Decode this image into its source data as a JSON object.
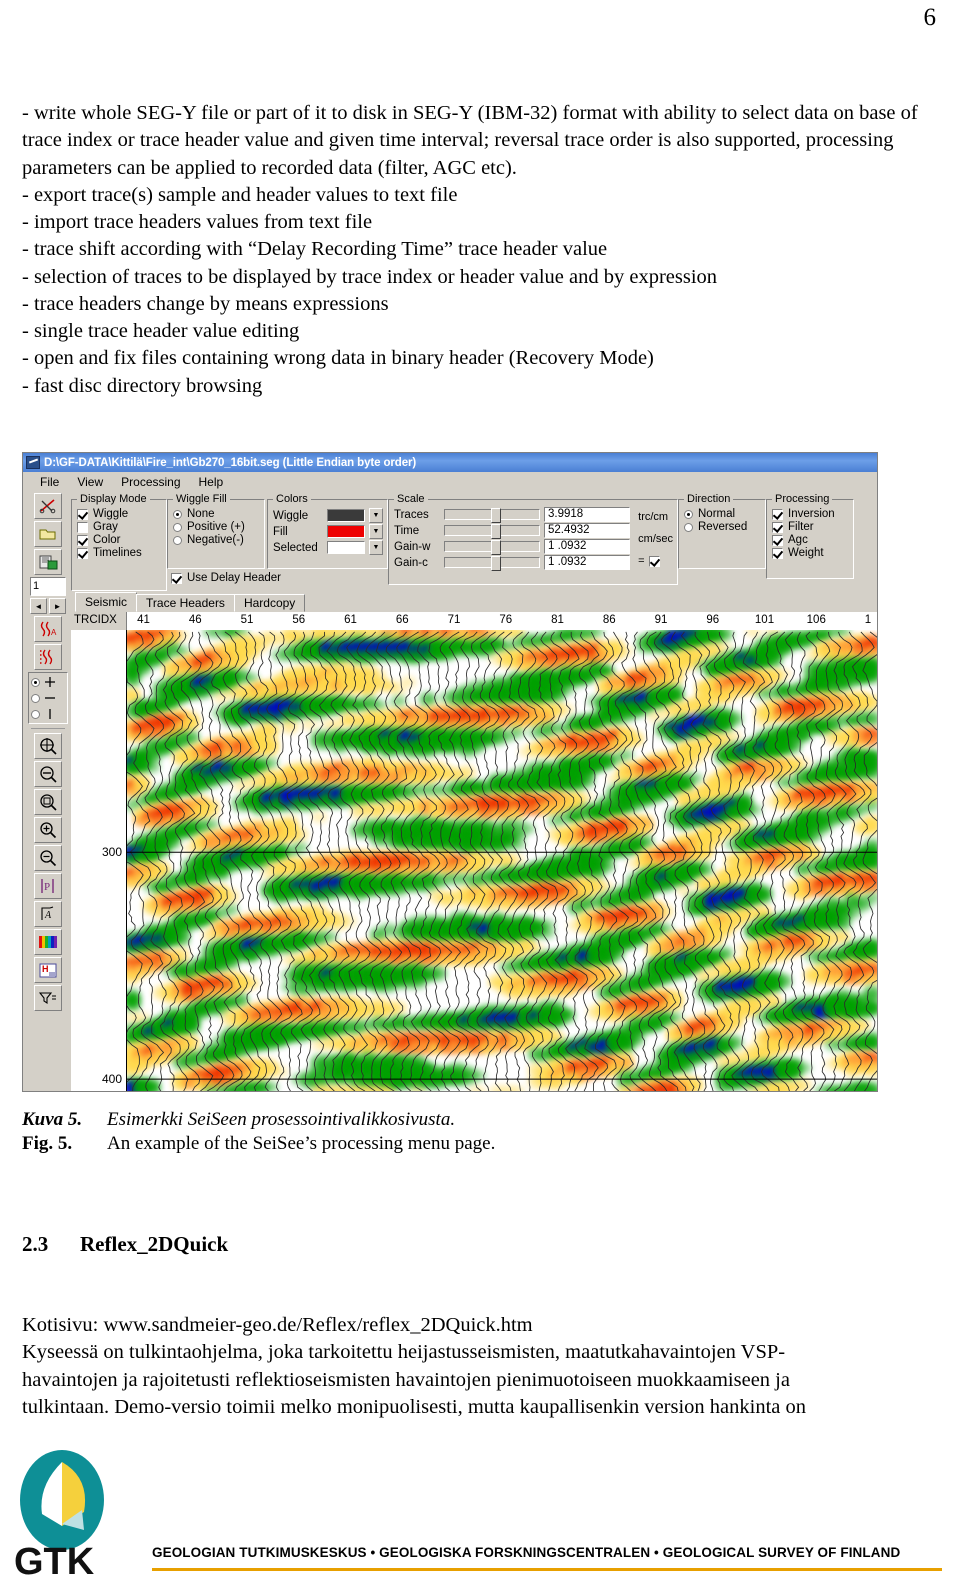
{
  "page": {
    "number": "6"
  },
  "prose": {
    "paragraph": "- write whole SEG-Y file or part of it to disk in SEG-Y (IBM-32) format with ability to select data on base of trace index or trace header value and given time interval; reversal trace order is also supported, processing parameters can be applied to recorded data (filter, AGC etc).",
    "bullets": [
      "- export trace(s) sample and header values to text file",
      "- import trace headers values from text file",
      "- trace shift according with “Delay Recording Time” trace header value",
      "- selection of traces to be displayed by trace index or header value and by expression",
      "- trace headers change by means expressions",
      "- single trace header value editing",
      "- open and fix files containing wrong data in binary header (Recovery Mode)",
      "- fast disc directory browsing"
    ]
  },
  "app": {
    "title": "D:\\GF-DATA\\Kittilä\\Fire_int\\Gb270_16bit.seg (Little Endian byte order)",
    "menu": [
      "File",
      "View",
      "Processing",
      "Help"
    ],
    "left_toolbar": {
      "trace_number_value": "1",
      "spin_prev": "◄",
      "spin_next": "►",
      "mode_radios": [
        {
          "name": "pan-mode",
          "selected": true
        },
        {
          "name": "horizontal-mode",
          "selected": false
        },
        {
          "name": "vertical-mode",
          "selected": false
        }
      ],
      "icons": [
        "cut-traces-icon",
        "open-file-icon",
        "save-file-icon",
        "trace-edit-icon",
        "trace-edit-2-icon",
        "zoom-fit-icon",
        "zoom-out-box-icon",
        "zoom-region-icon",
        "zoom-in-icon",
        "zoom-out-icon",
        "print-icon",
        "annotate-icon",
        "palette-icon",
        "header-icon",
        "filter-icon"
      ]
    },
    "groups": {
      "display_mode": {
        "legend": "Display Mode",
        "items": [
          {
            "label": "Wiggle",
            "checked": true
          },
          {
            "label": "Gray",
            "checked": false
          },
          {
            "label": "Color",
            "checked": true
          },
          {
            "label": "Timelines",
            "checked": true
          }
        ]
      },
      "wiggle_fill": {
        "legend": "Wiggle Fill",
        "items": [
          {
            "label": "None",
            "selected": true
          },
          {
            "label": "Positive (+)",
            "selected": false
          },
          {
            "label": "Negative(-)",
            "selected": false
          }
        ],
        "use_delay_header": {
          "label": "Use Delay  Header",
          "checked": true
        }
      },
      "colors": {
        "legend": "Colors",
        "items": [
          {
            "label": "Wiggle",
            "color": "#3a3a3a"
          },
          {
            "label": "Fill",
            "color": "#ee0000"
          },
          {
            "label": "Selected",
            "color": "#ffffff"
          }
        ]
      },
      "scale": {
        "legend": "Scale",
        "rows": [
          {
            "label": "Traces",
            "value": "3.9918",
            "unit": "trc/cm",
            "thumb": 46
          },
          {
            "label": "Time",
            "value": "52.4932",
            "unit": "cm/sec",
            "thumb": 46
          },
          {
            "label": "Gain-w",
            "value": "1 .0932",
            "unit": "",
            "thumb": 46
          },
          {
            "label": "Gain-c",
            "value": "1 .0932",
            "unit": "",
            "thumb": 46
          }
        ],
        "link_symbol": "=",
        "link_checked": true
      },
      "direction": {
        "legend": "Direction",
        "items": [
          {
            "label": "Normal",
            "selected": true
          },
          {
            "label": "Reversed",
            "selected": false
          }
        ]
      },
      "processing": {
        "legend": "Processing",
        "items": [
          {
            "label": "Inversion",
            "checked": true
          },
          {
            "label": "Filter",
            "checked": true
          },
          {
            "label": "Agc",
            "checked": true
          },
          {
            "label": "Weight",
            "checked": true
          }
        ]
      }
    },
    "tabs": [
      {
        "label": "Seismic",
        "active": true
      },
      {
        "label": "Trace Headers",
        "active": false
      },
      {
        "label": "Hardcopy",
        "active": false
      }
    ],
    "plot": {
      "x_axis_label": "TRCIDX",
      "x_ticks": [
        "41",
        "46",
        "51",
        "56",
        "61",
        "66",
        "71",
        "76",
        "81",
        "86",
        "91",
        "96",
        "101",
        "106",
        "1"
      ],
      "y_ticks": [
        "300",
        "400"
      ],
      "trace_colors": [
        "#00a000",
        "#ffd94a",
        "#0000cc",
        "#ee3300",
        "#ff9a33",
        "#ffffff"
      ]
    }
  },
  "caption": {
    "fi_key": "Kuva 5.",
    "fi_text": "Esimerkki SeiSeen prosessointivalikkosivusta.",
    "en_key": "Fig. 5.",
    "en_text": "An example of the SeiSee’s processing menu page."
  },
  "section": {
    "number": "2.3",
    "title": "Reflex_2DQuick"
  },
  "section_body": {
    "homepage": "Kotisivu: www.sandmeier-geo.de/Reflex/reflex_2DQuick.htm",
    "lines": [
      "Kyseessä on tulkintaohjelma, joka tarkoitettu heijastusseismisten, maatutkahavaintojen VSP-",
      "havaintojen ja rajoitetusti reflektioseismisten havaintojen pienimuotoiseen muokkaamiseen ja",
      "tulkintaan. Demo-versio toimii melko monipuolisesti, mutta kaupallisenkin version hankinta on"
    ]
  },
  "footer": {
    "logo_text": "GTK",
    "organizations": "GEOLOGIAN TUTKIMUSKESKUS  •  GEOLOGISKA FORSKNINGSCENTRALEN  •  GEOLOGICAL SURVEY OF FINLAND",
    "accent_color": "#e8a000",
    "logo_teal": "#0e8f96",
    "logo_yellow": "#f5d03c"
  }
}
